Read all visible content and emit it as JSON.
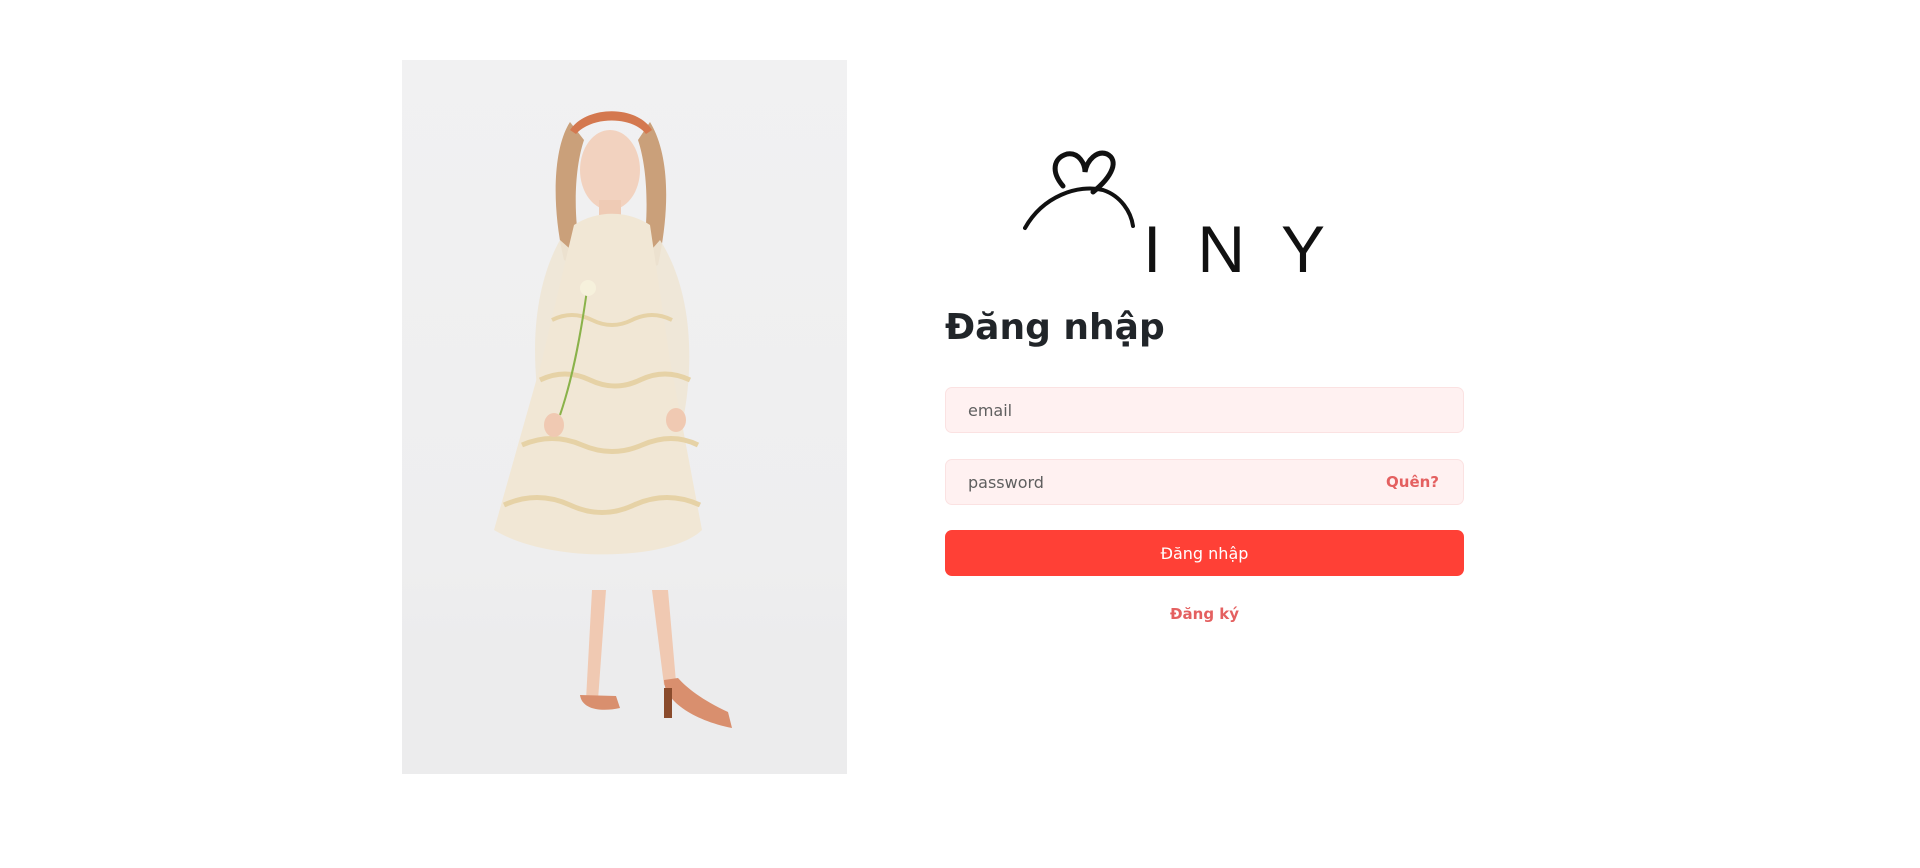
{
  "brand": {
    "logo_letters": "INY",
    "logo_icon": "hanger-heart-icon"
  },
  "hero": {
    "image_icon": "fashion-model-photo"
  },
  "login": {
    "heading": "Đăng nhập",
    "email_placeholder": "email",
    "password_placeholder": "password",
    "forgot_label": "Quên?",
    "submit_label": "Đăng nhập",
    "register_label": "Đăng ký"
  },
  "colors": {
    "primary": "#ff4036",
    "link": "#e46060",
    "field_bg": "#fff1f1",
    "heading": "#212529"
  }
}
